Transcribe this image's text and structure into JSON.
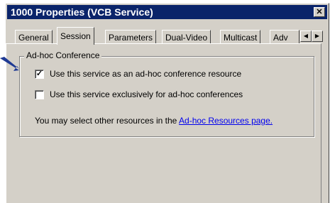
{
  "window": {
    "title": "1000 Properties (VCB Service)",
    "close_glyph": "✕"
  },
  "tabs": [
    {
      "label": "General",
      "selected": false
    },
    {
      "label": "Session",
      "selected": true
    },
    {
      "label": "Parameters",
      "selected": false
    },
    {
      "label": "Dual-Video",
      "selected": false
    },
    {
      "label": "Multicast",
      "selected": false
    },
    {
      "label": "Adv",
      "selected": false
    }
  ],
  "tab_scroll": {
    "left_glyph": "◀",
    "right_glyph": "▶"
  },
  "group": {
    "title": "Ad-hoc Conference",
    "options": [
      {
        "label": "Use this service as an ad-hoc conference resource",
        "checked": true
      },
      {
        "label": "Use this service exclusively for ad-hoc conferences",
        "checked": false
      }
    ],
    "note_text": "You may select other resources in the ",
    "note_link": "Ad-hoc Resources page."
  },
  "colors": {
    "titlebar": "#0a246a",
    "dialog_face": "#d4d0c8",
    "callout_arrow": "#1f3a93",
    "link": "#0000ee"
  }
}
